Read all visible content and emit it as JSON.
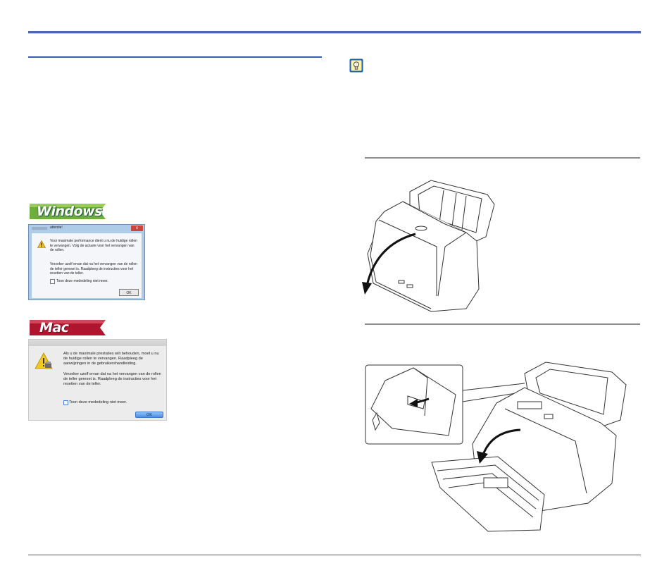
{
  "os_labels": {
    "windows": "Windows",
    "mac": "Mac"
  },
  "windows_dialog": {
    "title": "attentie!",
    "close_glyph": "x",
    "message1": "Voor maximale performance dient u nu de huidige rollen te vervangen. Volg de actuele voor het vervangen van de rollen.",
    "message2": "Verzeker uzelf ervan dat na het vervangen van de rollen de teller gereset is. Raadpleeg de instructies voor het resetten van de teller.",
    "checkbox_label": "Toon deze mededeling niet meer.",
    "ok_label": "OK"
  },
  "mac_dialog": {
    "message1": "Als u de maximale prestaties wilt behouden, moet u nu de huidige rollen te vervangen. Raadpleeg de aanwijzingen in de gebruikershandleiding.",
    "message2": "Verzeker uzelf ervan dat na het vervangen van de rollen de teller gereset is. Raadpleeg de instructies voor het resetten van de teller.",
    "checkbox_label": "Toon deze mededeling niet meer.",
    "ok_label": "OK"
  },
  "icons": {
    "tip": "lightbulb-icon",
    "warning": "warning-icon"
  },
  "colors": {
    "header_rule": "#4a68b8",
    "windows_tag": "#6fae3a",
    "mac_tag": "#b0152f",
    "tip_icon_bg": "#1d5fb0"
  }
}
